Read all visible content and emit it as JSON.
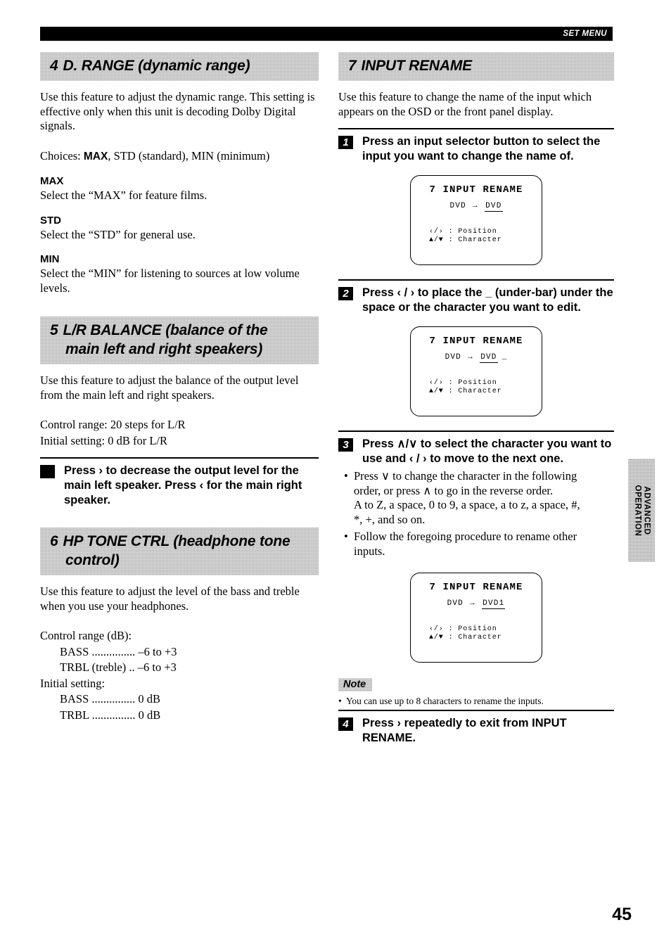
{
  "header": {
    "label": "SET MENU"
  },
  "page_number": "45",
  "side_tab": {
    "line1": "ADVANCED",
    "line2": "OPERATION"
  },
  "left_column": {
    "section4": {
      "number": "4",
      "title": "D. RANGE (dynamic range)",
      "intro": "Use this feature to adjust the dynamic range. This setting is effective only when this unit is decoding Dolby Digital signals.",
      "choices_prefix": "Choices: ",
      "choices_bold": "MAX",
      "choices_rest": ", STD (standard), MIN (minimum)",
      "options": [
        {
          "name": "MAX",
          "desc": "Select the “MAX” for feature films."
        },
        {
          "name": "STD",
          "desc": "Select the “STD” for general use."
        },
        {
          "name": "MIN",
          "desc": "Select the “MIN” for listening to sources at low volume levels."
        }
      ]
    },
    "section5": {
      "number": "5",
      "title_line1": "L/R BALANCE (balance of the",
      "title_line2": "main left and right speakers)",
      "intro": "Use this feature to adjust the balance of the output level from the main left and right speakers.",
      "control_range": "Control range: 20 steps for L/R",
      "initial_setting": "Initial setting:  0 dB for L/R",
      "step": {
        "marker": "",
        "text": "Press › to decrease the output level for the main left speaker. Press ‹ for the main right speaker."
      }
    },
    "section6": {
      "number": "6",
      "title_line1": "HP TONE CTRL (headphone tone",
      "title_line2": "control)",
      "intro": "Use this feature to adjust the level of the bass and treble when you use your headphones.",
      "control_range_label": "Control range (dB):",
      "control_range_rows": [
        "BASS ............... –6 to +3",
        "TRBL (treble) .. –6 to +3"
      ],
      "initial_setting_label": "Initial setting:",
      "initial_setting_rows": [
        "BASS ............... 0 dB",
        "TRBL ............... 0 dB"
      ]
    }
  },
  "right_column": {
    "section7": {
      "number": "7",
      "title": "INPUT RENAME",
      "intro": "Use this feature to change the name of the input which appears on the OSD or the front panel display.",
      "steps": [
        {
          "marker": "1",
          "text": "Press an input selector button to select the input you want to change the name of."
        },
        {
          "marker": "2",
          "text": "Press ‹ / › to place the _ (under-bar) under the space or the character you want to edit."
        },
        {
          "marker": "3",
          "text": "Press ∧/∨ to select the character you want to use and ‹ / › to move to the next one."
        },
        {
          "marker": "4",
          "text": "Press › repeatedly to exit from INPUT RENAME."
        }
      ],
      "step3_bullets": [
        {
          "line1": "Press ∨ to change the character in the following",
          "line2": "order, or press ∧ to go in the reverse order.",
          "line3": "A to Z, a space, 0 to 9, a space, a to z, a space, #,",
          "line4": "*, +, and so on."
        },
        {
          "line1": "Follow the foregoing procedure to rename other",
          "line2": "inputs."
        }
      ],
      "note": {
        "tag": "Note",
        "bullet": "You can use up to 8 characters to rename the inputs."
      }
    },
    "osd_screens": [
      {
        "title": "7 INPUT RENAME",
        "source": "DVD",
        "arrow": "→",
        "value": "DVD",
        "cursor": "",
        "legend_line1": "‹/› : Position",
        "legend_line2": "▲/▼ : Character"
      },
      {
        "title": "7 INPUT RENAME",
        "source": "DVD",
        "arrow": "→",
        "value": "DVD",
        "cursor": "_",
        "legend_line1": "‹/› : Position",
        "legend_line2": "▲/▼ : Character"
      },
      {
        "title": "7 INPUT RENAME",
        "source": "DVD",
        "arrow": "→",
        "value": "DVD1",
        "cursor": "",
        "legend_line1": "‹/› : Position",
        "legend_line2": "▲/▼ : Character"
      }
    ]
  }
}
